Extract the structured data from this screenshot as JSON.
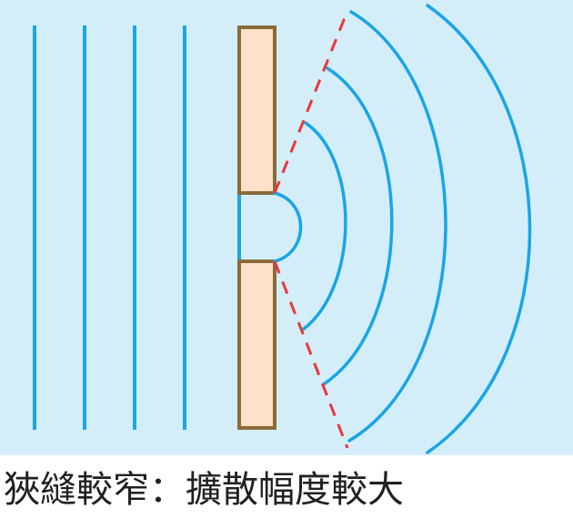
{
  "caption": {
    "text": "狹縫較窄：擴散幅度較大"
  },
  "colors": {
    "background": "#d3eef9",
    "wave": "#1aa5e6",
    "barrier_fill": "#fde1c8",
    "barrier_border": "#8a6a3a",
    "spread_line": "#e8383d",
    "caption_text": "#231f20"
  },
  "icons": {
    "barrier": "slit-barrier",
    "incident_waves": "plane-wavefronts",
    "diffracted_waves": "circular-wavefronts",
    "spread_boundary": "dashed-spread-lines"
  }
}
